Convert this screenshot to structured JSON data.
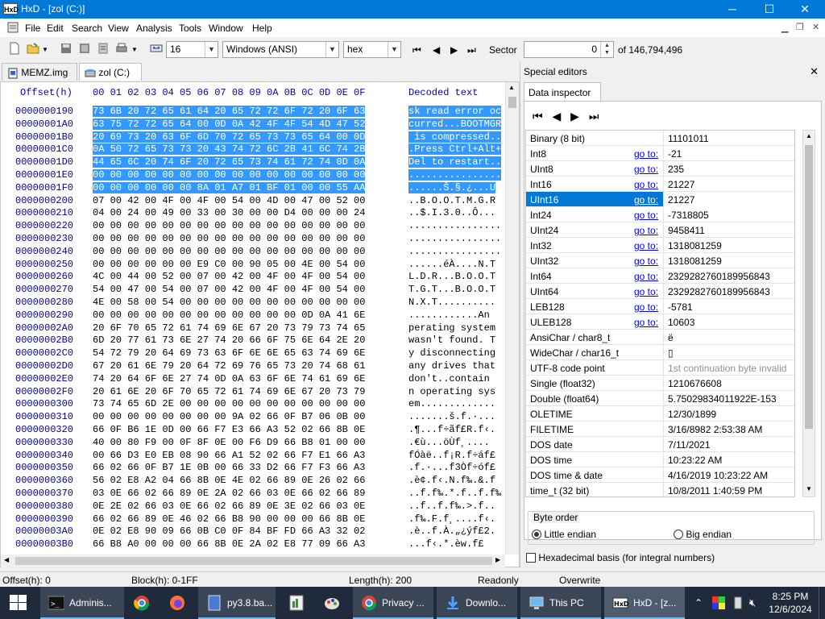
{
  "window": {
    "title": "HxD - [zol (C:)]",
    "min": "─",
    "max": "☐",
    "close": "✕"
  },
  "menu": [
    "File",
    "Edit",
    "Search",
    "View",
    "Analysis",
    "Tools",
    "Window",
    "Help"
  ],
  "toolbar": {
    "columns": "16",
    "charset": "Windows (ANSI)",
    "offset_base": "hex",
    "sector_label": "Sector",
    "sector_value": "0",
    "sector_of": "of 146,794,496"
  },
  "tabs": [
    "MEMZ.img",
    "zol (C:)"
  ],
  "hex": {
    "header_offset": "Offset(h)",
    "header_cols": "00 01 02 03 04 05 06 07 08 09 0A 0B 0C 0D 0E 0F",
    "header_decoded": "Decoded text",
    "rows": [
      {
        "off": "0000000190",
        "hex": "73 6B 20 72 65 61 64 20 65 72 72 6F 72 20 6F 63",
        "dec": "sk read error oc",
        "sel": true
      },
      {
        "off": "00000001A0",
        "hex": "63 75 72 72 65 64 00 0D 0A 42 4F 4F 54 4D 47 52",
        "dec": "curred...BOOTMGR",
        "sel": true
      },
      {
        "off": "00000001B0",
        "hex": "20 69 73 20 63 6F 6D 70 72 65 73 73 65 64 00 0D",
        "dec": " is compressed..",
        "sel": true
      },
      {
        "off": "00000001C0",
        "hex": "0A 50 72 65 73 73 20 43 74 72 6C 2B 41 6C 74 2B",
        "dec": ".Press Ctrl+Alt+",
        "sel": true
      },
      {
        "off": "00000001D0",
        "hex": "44 65 6C 20 74 6F 20 72 65 73 74 61 72 74 0D 0A",
        "dec": "Del to restart..",
        "sel": true
      },
      {
        "off": "00000001E0",
        "hex": "00 00 00 00 00 00 00 00 00 00 00 00 00 00 00 00",
        "dec": "................",
        "sel": true
      },
      {
        "off": "00000001F0",
        "hex": "00 00 00 00 00 00 8A 01 A7 01 BF 01 00 00 55 AA",
        "dec": "......Š.§.¿...U",
        "sel": true
      },
      {
        "off": "0000000200",
        "hex": "07 00 42 00 4F 00 4F 00 54 00 4D 00 47 00 52 00",
        "dec": "..B.O.O.T.M.G.R",
        "sel": false
      },
      {
        "off": "0000000210",
        "hex": "04 00 24 00 49 00 33 00 30 00 00 D4 00 00 00 24",
        "dec": "..$.I.3.0..Ô...",
        "sel": false
      },
      {
        "off": "0000000220",
        "hex": "00 00 00 00 00 00 00 00 00 00 00 00 00 00 00 00",
        "dec": "................",
        "sel": false
      },
      {
        "off": "0000000230",
        "hex": "00 00 00 00 00 00 00 00 00 00 00 00 00 00 00 00",
        "dec": "................",
        "sel": false
      },
      {
        "off": "0000000240",
        "hex": "00 00 00 00 00 00 00 00 00 00 00 00 00 00 00 00",
        "dec": "................",
        "sel": false
      },
      {
        "off": "0000000250",
        "hex": "00 00 00 00 00 00 E9 C0 00 90 05 00 4E 00 54 00",
        "dec": "......éÀ....N.T",
        "sel": false
      },
      {
        "off": "0000000260",
        "hex": "4C 00 44 00 52 00 07 00 42 00 4F 00 4F 00 54 00",
        "dec": "L.D.R...B.O.O.T",
        "sel": false
      },
      {
        "off": "0000000270",
        "hex": "54 00 47 00 54 00 07 00 42 00 4F 00 4F 00 54 00",
        "dec": "T.G.T...B.O.O.T",
        "sel": false
      },
      {
        "off": "0000000280",
        "hex": "4E 00 58 00 54 00 00 00 00 00 00 00 00 00 00 00",
        "dec": "N.X.T..........",
        "sel": false
      },
      {
        "off": "0000000290",
        "hex": "00 00 00 00 00 00 00 00 00 00 00 00 0D 0A 41 6E",
        "dec": "............An",
        "sel": false
      },
      {
        "off": "00000002A0",
        "hex": "20 6F 70 65 72 61 74 69 6E 67 20 73 79 73 74 65",
        "dec": "perating system",
        "sel": false
      },
      {
        "off": "00000002B0",
        "hex": "6D 20 77 61 73 6E 27 74 20 66 6F 75 6E 64 2E 20",
        "dec": "wasn't found. T",
        "sel": false
      },
      {
        "off": "00000002C0",
        "hex": "54 72 79 20 64 69 73 63 6F 6E 6E 65 63 74 69 6E",
        "dec": "y disconnecting",
        "sel": false
      },
      {
        "off": "00000002D0",
        "hex": "67 20 61 6E 79 20 64 72 69 76 65 73 20 74 68 61",
        "dec": "any drives that",
        "sel": false
      },
      {
        "off": "00000002E0",
        "hex": "74 20 64 6F 6E 27 74 0D 0A 63 6F 6E 74 61 69 6E",
        "dec": "don't..contain",
        "sel": false
      },
      {
        "off": "00000002F0",
        "hex": "20 61 6E 20 6F 70 65 72 61 74 69 6E 67 20 73 79",
        "dec": "n operating sys",
        "sel": false
      },
      {
        "off": "0000000300",
        "hex": "73 74 65 6D 2E 00 00 00 00 00 00 00 00 00 00 00",
        "dec": "em.............",
        "sel": false
      },
      {
        "off": "0000000310",
        "hex": "00 00 00 00 00 00 00 00 9A 02 66 0F B7 06 0B 00",
        "dec": ".......š.f.·...",
        "sel": false
      },
      {
        "off": "0000000320",
        "hex": "66 0F B6 1E 0D 00 66 F7 E3 66 A3 52 02 66 8B 0E",
        "dec": ".¶...f÷ãf£R.f‹.",
        "sel": false
      },
      {
        "off": "0000000330",
        "hex": "40 00 80 F9 00 0F 8F 0E 00 F6 D9 66 B8 01 00 00",
        "dec": ".€ù...öÙf¸....",
        "sel": false
      },
      {
        "off": "0000000340",
        "hex": "00 66 D3 E0 EB 08 90 66 A1 52 02 66 F7 E1 66 A3",
        "dec": "fÓàë..f¡R.f÷áf£",
        "sel": false
      },
      {
        "off": "0000000350",
        "hex": "66 02 66 0F B7 1E 0B 00 66 33 D2 66 F7 F3 66 A3",
        "dec": ".f.·...f3Òf÷óf£",
        "sel": false
      },
      {
        "off": "0000000360",
        "hex": "56 02 E8 A2 04 66 8B 0E 4E 02 66 89 0E 26 02 66",
        "dec": ".è¢.f‹.N.f‰.&.f",
        "sel": false
      },
      {
        "off": "0000000370",
        "hex": "03 0E 66 02 66 89 0E 2A 02 66 03 0E 66 02 66 89",
        "dec": "..f.f‰.*.f..f.f‰",
        "sel": false
      },
      {
        "off": "0000000380",
        "hex": "0E 2E 02 66 03 0E 66 02 66 89 0E 3E 02 66 03 0E",
        "dec": "..f..f.f‰.>.f..",
        "sel": false
      },
      {
        "off": "0000000390",
        "hex": "66 02 66 89 0E 46 02 66 B8 90 00 00 00 66 8B 0E",
        "dec": ".f‰.F.f¸....f‹.",
        "sel": false
      },
      {
        "off": "00000003A0",
        "hex": "0E 02 E8 90 09 66 0B C0 0F 84 BF FD 66 A3 32 02",
        "dec": ".è..f.À.„¿ýf£2.",
        "sel": false
      },
      {
        "off": "00000003B0",
        "hex": "66 B8 A0 00 00 00 66 8B 0E 2A 02 E8 77 09 66 A3",
        "dec": "...f‹.*.èw.f£",
        "sel": false
      }
    ]
  },
  "special_editors": {
    "title": "Special editors",
    "close": "✕",
    "tab": "Data inspector",
    "goto": "go to:",
    "rows": [
      {
        "label": "Binary (8 bit)",
        "goto": false,
        "value": "11101011"
      },
      {
        "label": "Int8",
        "goto": true,
        "value": "-21"
      },
      {
        "label": "UInt8",
        "goto": true,
        "value": "235"
      },
      {
        "label": "Int16",
        "goto": true,
        "value": "21227"
      },
      {
        "label": "UInt16",
        "goto": true,
        "value": "21227",
        "hl": true
      },
      {
        "label": "Int24",
        "goto": true,
        "value": "-7318805"
      },
      {
        "label": "UInt24",
        "goto": true,
        "value": "9458411"
      },
      {
        "label": "Int32",
        "goto": true,
        "value": "1318081259"
      },
      {
        "label": "UInt32",
        "goto": true,
        "value": "1318081259"
      },
      {
        "label": "Int64",
        "goto": true,
        "value": "2329282760189956843"
      },
      {
        "label": "UInt64",
        "goto": true,
        "value": "2329282760189956843"
      },
      {
        "label": "LEB128",
        "goto": true,
        "value": "-5781"
      },
      {
        "label": "ULEB128",
        "goto": true,
        "value": "10603"
      },
      {
        "label": "AnsiChar / char8_t",
        "goto": false,
        "value": "ë"
      },
      {
        "label": "WideChar / char16_t",
        "goto": false,
        "value": "▯"
      },
      {
        "label": "UTF-8 code point",
        "goto": false,
        "value": "1st continuation byte invalid",
        "gray": true
      },
      {
        "label": "Single (float32)",
        "goto": false,
        "value": "1210676608"
      },
      {
        "label": "Double (float64)",
        "goto": false,
        "value": "5.75029834011922E-153"
      },
      {
        "label": "OLETIME",
        "goto": false,
        "value": "12/30/1899"
      },
      {
        "label": "FILETIME",
        "goto": false,
        "value": "3/16/8982 2:53:38 AM"
      },
      {
        "label": "DOS date",
        "goto": false,
        "value": "7/11/2021"
      },
      {
        "label": "DOS time",
        "goto": false,
        "value": "10:23:22 AM"
      },
      {
        "label": "DOS time & date",
        "goto": false,
        "value": "4/16/2019 10:23:22 AM"
      },
      {
        "label": "time_t (32 bit)",
        "goto": false,
        "value": "10/8/2011 1:40:59 PM"
      }
    ],
    "byte_order_label": "Byte order",
    "little_endian": "Little endian",
    "big_endian": "Big endian",
    "hex_basis": "Hexadecimal basis (for integral numbers)"
  },
  "status": {
    "offset": "Offset(h): 0",
    "block": "Block(h): 0-1FF",
    "length": "Length(h): 200",
    "mode": "Readonly",
    "insert": "Overwrite"
  },
  "taskbar": {
    "items": [
      "Adminis...",
      "py3.8.ba...",
      "Privacy ...",
      "Downlo...",
      "This PC",
      "HxD - [z..."
    ],
    "time": "8:25 PM",
    "date": "12/6/2024"
  },
  "colors": {
    "accent": "#0078d7",
    "selection": "#3399ff",
    "offset_text": "#0000a0",
    "link": "#0000ff"
  }
}
